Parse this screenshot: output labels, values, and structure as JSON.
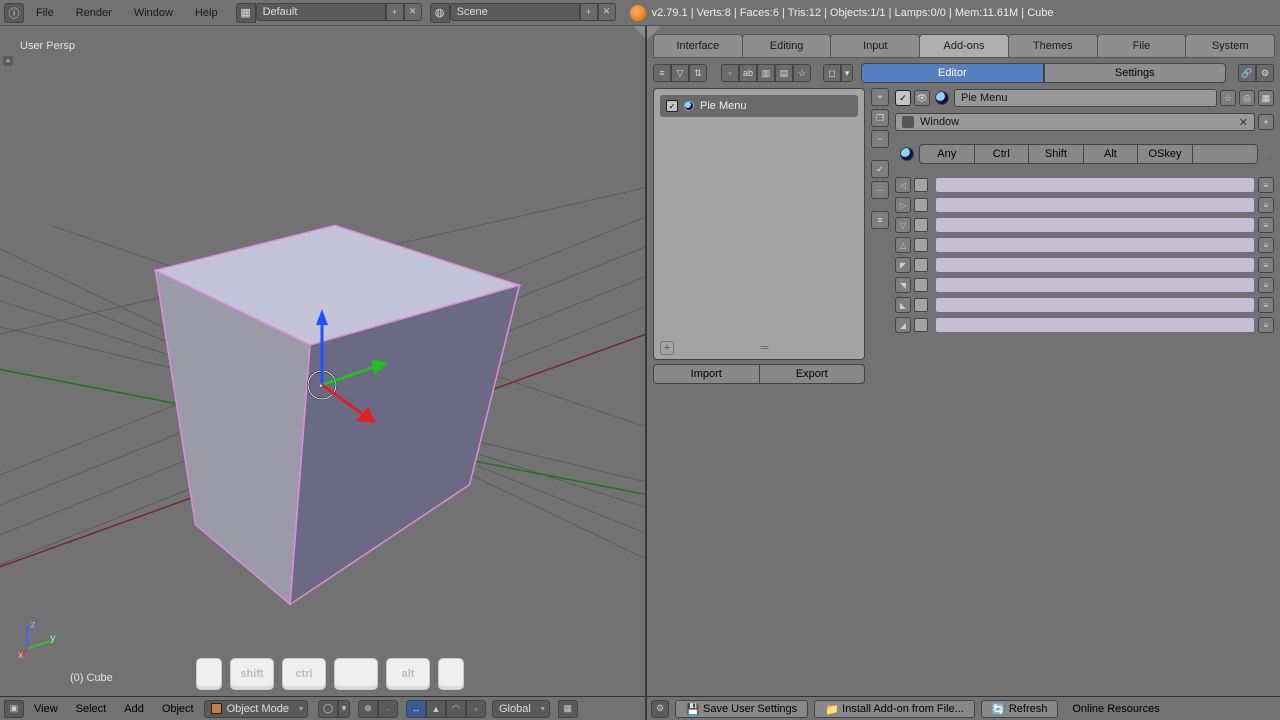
{
  "header": {
    "menus": [
      "File",
      "Render",
      "Window",
      "Help"
    ],
    "screen_layout": "Default",
    "scene_label": "Scene",
    "stats": "v2.79.1 | Verts:8 | Faces:6 | Tris:12 | Objects:1/1 | Lamps:0/0 | Mem:11.61M | Cube"
  },
  "viewport": {
    "persp_label": "User Persp",
    "object_label": "(0)  Cube",
    "key_hints": [
      "",
      "shift",
      "ctrl",
      "",
      "alt",
      ""
    ],
    "footer": {
      "menus": [
        "View",
        "Select",
        "Add",
        "Object"
      ],
      "mode": "Object Mode",
      "orientation": "Global"
    }
  },
  "prefs": {
    "tabs": [
      "Interface",
      "Editing",
      "Input",
      "Add-ons",
      "Themes",
      "File",
      "System"
    ],
    "active_tab": "Add-ons",
    "mode_tabs": [
      "Editor",
      "Settings"
    ],
    "active_mode": "Editor",
    "pie_menu": {
      "item_label": "Pie Menu",
      "import": "Import",
      "export": "Export"
    },
    "editor": {
      "title_value": "Pie Menu",
      "window_value": "Window",
      "modifiers": [
        "Any",
        "Ctrl",
        "Shift",
        "Alt",
        "OSkey"
      ]
    },
    "footer": {
      "save": "Save User Settings",
      "install": "Install Add-on from File...",
      "refresh": "Refresh",
      "online": "Online Resources"
    }
  }
}
